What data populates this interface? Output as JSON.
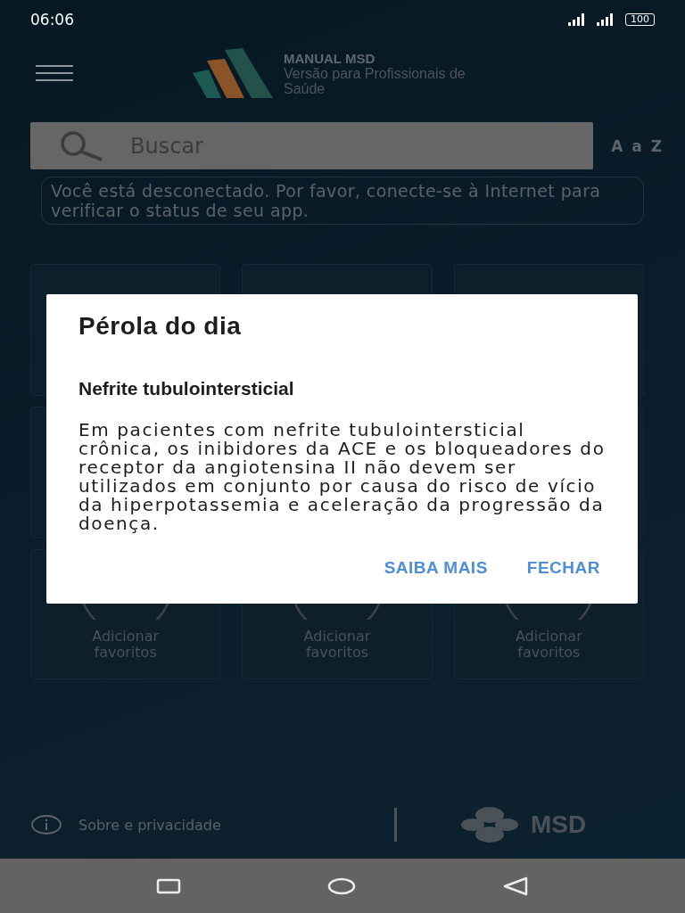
{
  "status_bar": {
    "time": "06:06",
    "battery": "100"
  },
  "header": {
    "brand": "MANUAL MSD",
    "subtitle": "Versão para Profissionais de Saúde"
  },
  "search": {
    "placeholder": "Buscar",
    "index_link": "A a Z"
  },
  "notice": "Você está desconectado. Por favor, conecte-se à Internet para verificar o status de seu app.",
  "favorites": [
    {
      "label": "Adicionar favoritos"
    },
    {
      "label": "Adicionar favoritos"
    },
    {
      "label": "Adicionar favoritos"
    }
  ],
  "footer": {
    "about_link": "Sobre e privacidade",
    "logo_text": "MSD"
  },
  "dialog": {
    "title": "Pérola do dia",
    "heading": "Nefrite tubulointersticial",
    "body": "Em pacientes com nefrite tubulointersticial crônica, os inibidores da ACE e os bloqueadores do receptor da angiotensina II não devem ser utilizados em conjunto por causa do risco de vício da hiperpotassemia e aceleração da progressão da doença.",
    "actions": [
      "SAIBA MAIS",
      "FECHAR"
    ]
  }
}
